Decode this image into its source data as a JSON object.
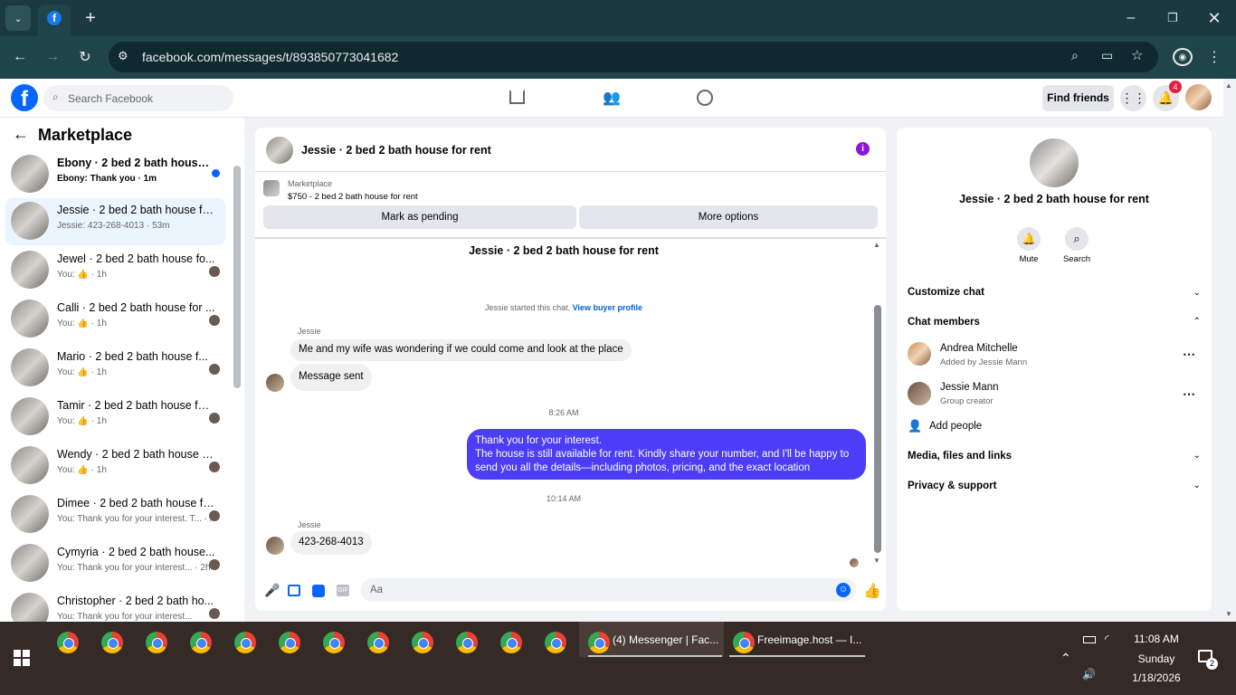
{
  "browser": {
    "url": "facebook.com/messages/t/893850773041682"
  },
  "fb": {
    "search_placeholder": "Search Facebook",
    "find_friends": "Find friends",
    "notif_count": "4"
  },
  "left": {
    "title": "Marketplace",
    "conversations": [
      {
        "name": "Ebony · 2 bed 2 bath house fo...",
        "preview": "Ebony: Thank you · 1m"
      },
      {
        "name": "Jessie · 2 bed 2 bath house for r...",
        "preview": "Jessie: 423-268-4013 · 53m"
      },
      {
        "name": "Jewel · 2 bed 2 bath house fo...",
        "preview": "You: 👍 · 1h"
      },
      {
        "name": "Calli · 2 bed 2 bath house for ...",
        "preview": "You: 👍 · 1h"
      },
      {
        "name": "Mario · 2 bed 2 bath house f...",
        "preview": "You: 👍 · 1h"
      },
      {
        "name": "Tamir · 2 bed 2 bath house for r...",
        "preview": "You: 👍 · 1h"
      },
      {
        "name": "Wendy · 2 bed 2 bath house for...",
        "preview": "You: 👍 · 1h"
      },
      {
        "name": "Dimee · 2 bed 2 bath house for ...",
        "preview": "You: Thank you for your interest. T... · 2h"
      },
      {
        "name": "Cymyria · 2 bed 2 bath house...",
        "preview": "You: Thank you for your interest... · 2h"
      },
      {
        "name": "Christopher · 2 bed 2 bath ho...",
        "preview": "You: Thank you for your interest..."
      }
    ]
  },
  "chat": {
    "title": "Jessie · 2 bed 2 bath house for rent",
    "listing_source": "Marketplace",
    "listing_price": "$750 - 2 bed 2 bath house for rent",
    "mark_pending": "Mark as pending",
    "more_options": "More options",
    "thread_title": "Jessie · 2 bed 2 bath house for rent",
    "started_text": "Jessie started this chat.",
    "view_profile": "View buyer profile",
    "sender1": "Jessie",
    "msg1": "Me and my wife was wondering if we could come and look at the place",
    "msg2": "Message sent",
    "time1": "8:26 AM",
    "reply_line1": "Thank you for your interest.",
    "reply_line2": "The house is still available for rent. Kindly share your number, and I'll be happy to",
    "reply_line3": "send you all the details—including photos, pricing, and the exact location",
    "time2": "10:14 AM",
    "sender2": "Jessie",
    "msg3": "423-268-4013",
    "input_placeholder": "Aa"
  },
  "right": {
    "title": "Jessie · 2 bed 2 bath house for rent",
    "mute": "Mute",
    "search": "Search",
    "customize": "Customize chat",
    "members": "Chat members",
    "member1_name": "Andrea Mitchelle",
    "member1_sub": "Added by Jessie Mann",
    "member2_name": "Jessie Mann",
    "member2_sub": "Group creator",
    "add_people": "Add people",
    "media": "Media, files and links",
    "privacy": "Privacy & support"
  },
  "taskbar": {
    "task1": "(4) Messenger | Fac...",
    "task2": "Freeimage.host — I...",
    "time": "11:08 AM",
    "day": "Sunday",
    "date": "1/18/2026",
    "notif": "2"
  }
}
